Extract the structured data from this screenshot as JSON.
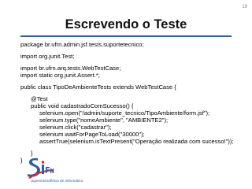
{
  "slide": {
    "number": "19",
    "title": "Escrevendo o Teste"
  },
  "code": {
    "line_package": "package br.ufrn.admin.jsf.tests.suportetecnico;",
    "line_import1": "import org.junit.Test;",
    "line_import2": "import br.ufrn.arq.tests.WebTestCase;",
    "line_import3": "import static org.junit.Assert.*;",
    "line_class": "public class TipoDeAmbienteTests extends WebTestCase {",
    "line_annotation": "@Test",
    "line_method": "public void cadastradoComSucesso() {",
    "line_open": "selenium.open(\"/admin/suporte_tecnico/TipoAmbiente/form.jsf\");",
    "line_type": "selenium.type(\"nomeAmbiente\", \"AMBIENTE2\");",
    "line_click": "selenium.click(\"cadastrar\");",
    "line_wait": "selenium.waitForPageToLoad(\"30000\");",
    "line_assert": "assertTrue(selenium.isTextPresent(\"Operação realizada com sucesso!\"));",
    "line_method_close": "}",
    "line_class_close": "}"
  },
  "logo": {
    "tagline": "Superintendência de Informática",
    "icon": "sinfo-logo",
    "colors": {
      "blue": "#2e5ea3",
      "red": "#d9232a"
    }
  },
  "colors": {
    "accent": "#2e5ea3"
  }
}
